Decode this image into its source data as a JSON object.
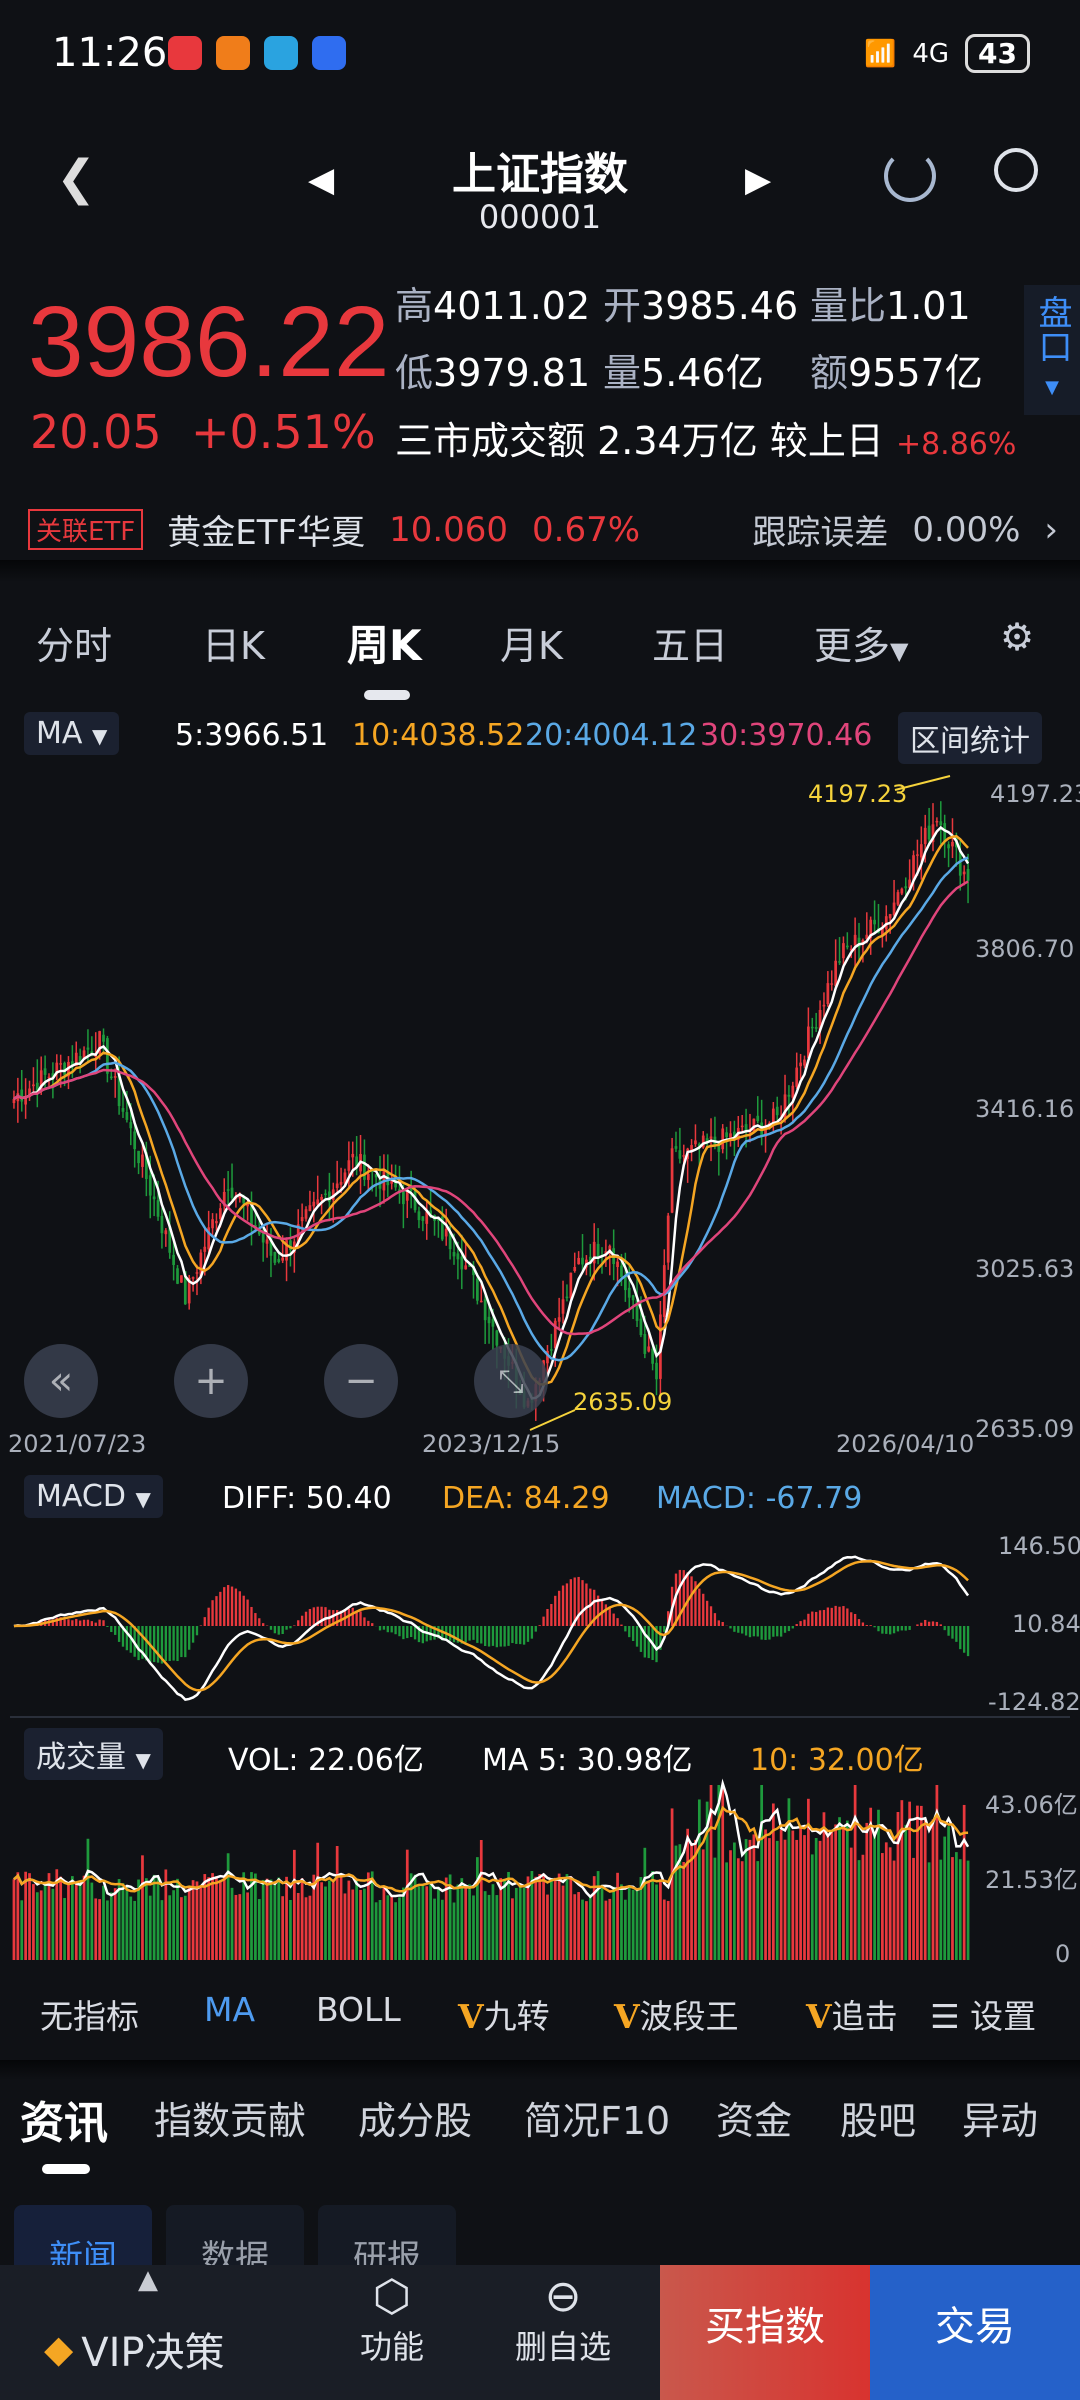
{
  "status": {
    "time": "11:26",
    "network": "4G",
    "battery": "43"
  },
  "header": {
    "title": "上证指数",
    "code": "000001"
  },
  "quote": {
    "price": "3986.22",
    "change": "20.05",
    "change_pct": "+0.51%",
    "high_label": "高",
    "high": "4011.02",
    "open_label": "开",
    "open": "3985.46",
    "ratio_label": "量比",
    "ratio": "1.01",
    "low_label": "低",
    "low": "3979.81",
    "vol_label": "量",
    "vol": "5.46亿",
    "amt_label": "额",
    "amt": "9557亿",
    "market_label": "三市成交额",
    "market_amt": "2.34万亿",
    "vs_label": "较上日",
    "vs_pct": "+8.86%",
    "pankou": "盘口"
  },
  "etf": {
    "tag": "关联ETF",
    "name": "黄金ETF华夏",
    "price": "10.060",
    "pct": "0.67%",
    "err_label": "跟踪误差",
    "err": "0.00%"
  },
  "period_tabs": [
    "分时",
    "日K",
    "周K",
    "月K",
    "五日",
    "更多"
  ],
  "active_tab": "周K",
  "ma": {
    "label": "MA",
    "ma5": "5:3966.51",
    "ma10": "10:4038.52",
    "ma20": "20:4004.12",
    "ma30": "30:3970.46",
    "stats_btn": "区间统计"
  },
  "colors": {
    "up": "#e8383d",
    "down": "#1e9a3c",
    "ma5": "#ffffff",
    "ma10": "#f5a623",
    "ma20": "#5aa9e6",
    "ma30": "#e0457b"
  },
  "chart_data": {
    "type": "candlestick",
    "period": "weekly",
    "price_axis": [
      "4197.23",
      "3806.70",
      "3416.16",
      "3025.63",
      "2635.09"
    ],
    "ylim": [
      2635.09,
      4197.23
    ],
    "date_labels": [
      "2021/07/23",
      "2023/12/15",
      "2026/04/10"
    ],
    "max_label": "4197.23",
    "min_label": "2635.09",
    "close_keypoints_week_price": [
      [
        0,
        3450
      ],
      [
        1,
        3460
      ],
      [
        22,
        3590
      ],
      [
        36,
        3200
      ],
      [
        44,
        2960
      ],
      [
        55,
        3250
      ],
      [
        67,
        3050
      ],
      [
        87,
        3300
      ],
      [
        102,
        3200
      ],
      [
        114,
        3080
      ],
      [
        132,
        2700
      ],
      [
        145,
        3050
      ],
      [
        153,
        3100
      ],
      [
        165,
        2760
      ],
      [
        169,
        3300
      ],
      [
        177,
        3330
      ],
      [
        196,
        3400
      ],
      [
        212,
        3800
      ],
      [
        224,
        3900
      ],
      [
        237,
        4150
      ],
      [
        245,
        3986
      ]
    ],
    "macd": {
      "header": "MACD",
      "diff": "DIFF: 50.40",
      "dea": "DEA: 84.29",
      "macd": "MACD: -67.79",
      "axis": [
        "146.50",
        "10.84",
        "-124.82"
      ]
    },
    "volume": {
      "header": "成交量",
      "vol": "VOL: 22.06亿",
      "ma5": "MA 5: 30.98亿",
      "ma10": "10: 32.00亿",
      "axis": [
        "43.06亿",
        "21.53亿",
        "0"
      ]
    }
  },
  "indicators": [
    "无指标",
    "MA",
    "BOLL",
    "九转",
    "波段王",
    "追击",
    "设置"
  ],
  "indicator_v": "V",
  "sections": [
    "资讯",
    "指数贡献",
    "成分股",
    "简况F10",
    "资金",
    "股吧",
    "异动"
  ],
  "subtabs": [
    "新闻",
    "数据",
    "研报"
  ],
  "bottom": {
    "vip": "VIP决策",
    "func": "功能",
    "remove": "删自选",
    "buy": "买指数",
    "trade": "交易"
  }
}
